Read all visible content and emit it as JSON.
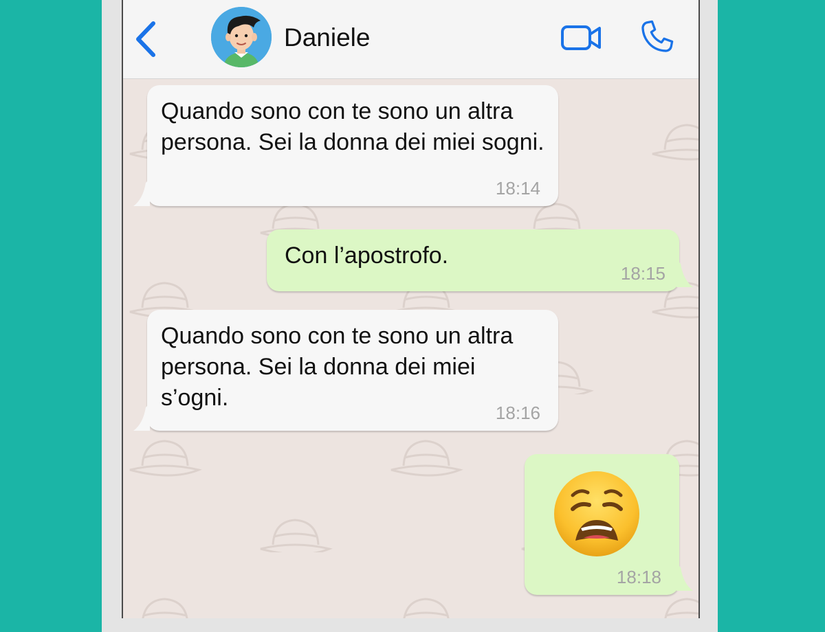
{
  "contact": {
    "name": "Daniele"
  },
  "header": {
    "icons": [
      "chevron-left-icon",
      "video-camera-icon",
      "phone-icon"
    ],
    "accent_color": "#1a73e8"
  },
  "messages": [
    {
      "direction": "incoming",
      "text": "Quando sono con te sono un altra persona. Sei la donna dei miei sogni.",
      "time": "18:14"
    },
    {
      "direction": "outgoing",
      "text": "Con l’apostrofo.",
      "time": "18:15"
    },
    {
      "direction": "incoming",
      "text": "Quando sono con te sono un altra persona. Sei la donna dei miei s’ogni.",
      "time": "18:16"
    },
    {
      "direction": "outgoing",
      "emoji": "weary-face",
      "time": "18:18"
    }
  ],
  "colors": {
    "background": "#1bb5a6",
    "incoming_bubble": "#f7f7f7",
    "outgoing_bubble": "#dcf7c5",
    "chat_wallpaper": "#ede4e0"
  }
}
